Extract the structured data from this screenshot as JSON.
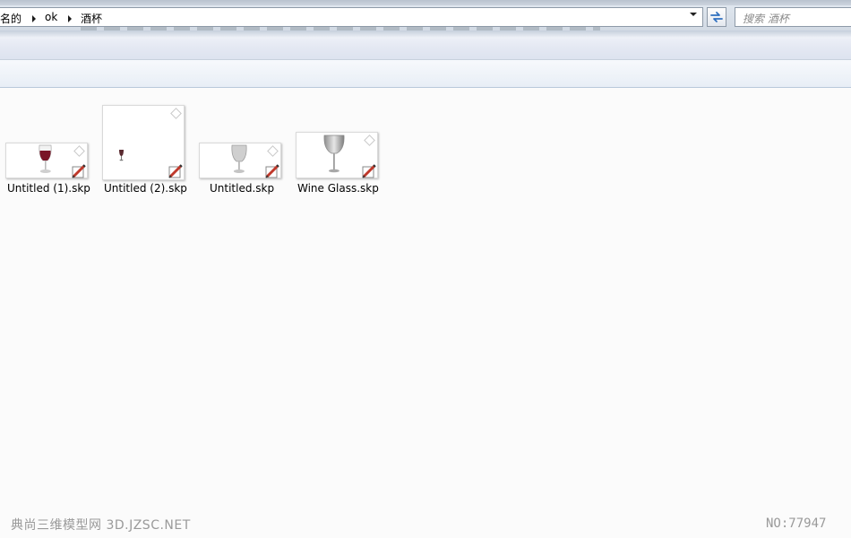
{
  "address_bar": {
    "breadcrumbs": [
      "名的",
      "ok",
      "酒杯"
    ]
  },
  "search": {
    "placeholder": "搜索 酒杯"
  },
  "files": [
    {
      "name": "Untitled (1).skp",
      "icon": "wine-glass-red-thumbnail"
    },
    {
      "name": "Untitled (2).skp",
      "icon": "small-wine-glass-thumbnail"
    },
    {
      "name": "Untitled.skp",
      "icon": "grey-glass-thumbnail"
    },
    {
      "name": "Wine Glass.skp",
      "icon": "silver-wine-glass-thumbnail"
    }
  ],
  "watermark": {
    "left": "典尚三维模型网 3D.JZSC.NET",
    "right": "NO:77947"
  },
  "colors": {
    "wine": "#7a1426",
    "sketchup_badge": "#c0392b"
  }
}
